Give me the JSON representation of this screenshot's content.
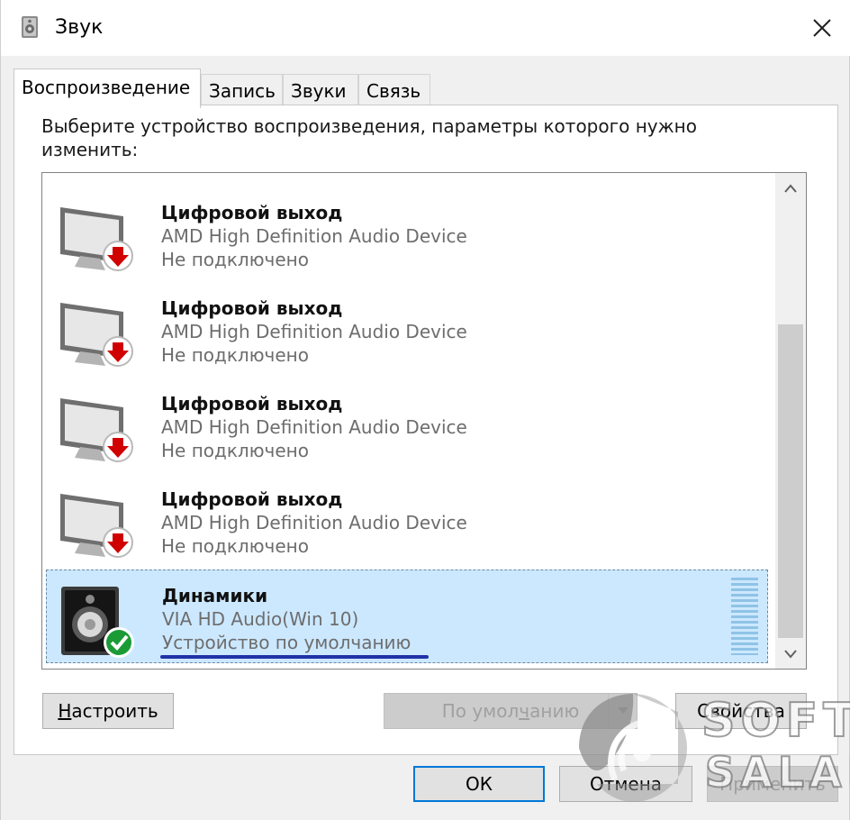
{
  "window": {
    "title": "Звук",
    "icon": "speaker-icon",
    "close_glyph": "✕"
  },
  "tabs": [
    {
      "label": "Воспроизведение",
      "active": true
    },
    {
      "label": "Запись",
      "active": false
    },
    {
      "label": "Звуки",
      "active": false
    },
    {
      "label": "Связь",
      "active": false
    }
  ],
  "instruction": "Выберите устройство воспроизведения, параметры которого нужно изменить:",
  "devices": [
    {
      "name": "Цифровой выход",
      "description": "AMD High Definition Audio Device",
      "status": "Не подключено",
      "icon": "monitor-disconnected-icon",
      "selected": false
    },
    {
      "name": "Цифровой выход",
      "description": "AMD High Definition Audio Device",
      "status": "Не подключено",
      "icon": "monitor-disconnected-icon",
      "selected": false
    },
    {
      "name": "Цифровой выход",
      "description": "AMD High Definition Audio Device",
      "status": "Не подключено",
      "icon": "monitor-disconnected-icon",
      "selected": false
    },
    {
      "name": "Цифровой выход",
      "description": "AMD High Definition Audio Device",
      "status": "Не подключено",
      "icon": "monitor-disconnected-icon",
      "selected": false
    },
    {
      "name": "Динамики",
      "description": "VIA HD Audio(Win 10)",
      "status": "Устройство по умолчанию",
      "icon": "speaker-default-icon",
      "selected": true
    }
  ],
  "buttons": {
    "configure": {
      "pre": "",
      "key": "Н",
      "post": "астроить"
    },
    "set_default": {
      "pre": "По умол",
      "key": "ч",
      "post": "анию"
    },
    "properties": "Свойства",
    "ok": "ОК",
    "cancel": "Отмена",
    "apply": "Применить"
  },
  "watermark": {
    "line1": "SOFT",
    "line2": "SALAD"
  },
  "colors": {
    "selection": "#cce8ff",
    "accent": "#0078d7",
    "disconnected_badge": "#d00000",
    "default_badge": "#1a9b36"
  }
}
